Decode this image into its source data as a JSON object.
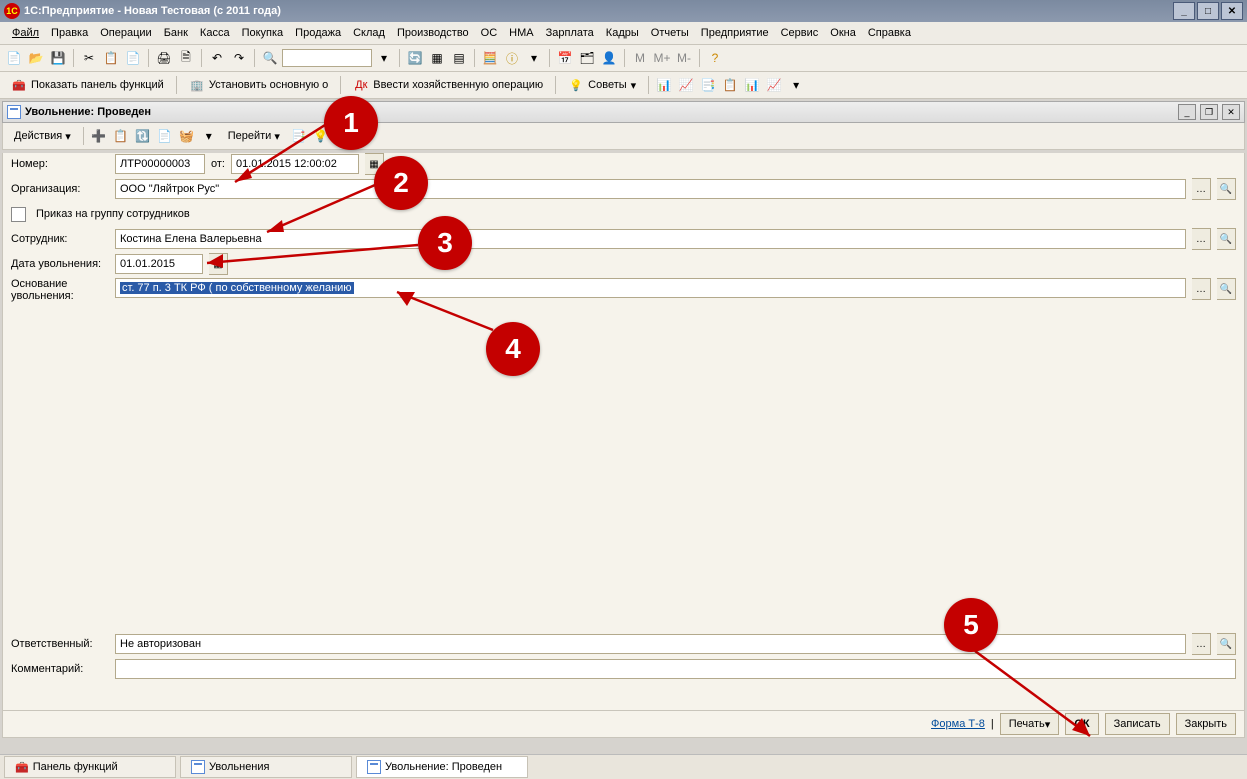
{
  "window": {
    "title": "1С:Предприятие - Новая Тестовая (с 2011 года)"
  },
  "menu": [
    "Файл",
    "Правка",
    "Операции",
    "Банк",
    "Касса",
    "Покупка",
    "Продажа",
    "Склад",
    "Производство",
    "ОС",
    "НМА",
    "Зарплата",
    "Кадры",
    "Отчеты",
    "Предприятие",
    "Сервис",
    "Окна",
    "Справка"
  ],
  "toolbar2": {
    "show_panel": "Показать панель функций",
    "set_main": "Установить основную о",
    "enter_op": "Ввести хозяйственную операцию",
    "tips": "Советы"
  },
  "mlabels": {
    "m": "М",
    "mplus": "М+",
    "mminus": "М-"
  },
  "document": {
    "header": "Увольнение: Проведен",
    "actions": "Действия",
    "goto": "Перейти"
  },
  "form": {
    "number_label": "Номер:",
    "number": "ЛТР00000003",
    "from_label": "от:",
    "date_time": "01.01.2015 12:00:02",
    "org_label": "Организация:",
    "org": "ООО \"Ляйтрок Рус\"",
    "group_order": "Приказ на группу сотрудников",
    "employee_label": "Сотрудник:",
    "employee": "Костина Елена Валерьевна",
    "fire_date_label": "Дата увольнения:",
    "fire_date": "01.01.2015",
    "reason_label1": "Основание",
    "reason_label2": "увольнения:",
    "reason": "ст. 77 п. 3 ТК РФ ( по собственному желанию",
    "responsible_label": "Ответственный:",
    "responsible": "Не авторизован",
    "comment_label": "Комментарий:",
    "comment": ""
  },
  "footer": {
    "form_t8": "Форма Т-8",
    "print": "Печать",
    "ok": "ОК",
    "save": "Записать",
    "close": "Закрыть"
  },
  "taskbar": {
    "panel": "Панель функций",
    "list": "Увольнения",
    "doc": "Увольнение: Проведен"
  },
  "callouts": {
    "c1": "1",
    "c2": "2",
    "c3": "3",
    "c4": "4",
    "c5": "5"
  }
}
